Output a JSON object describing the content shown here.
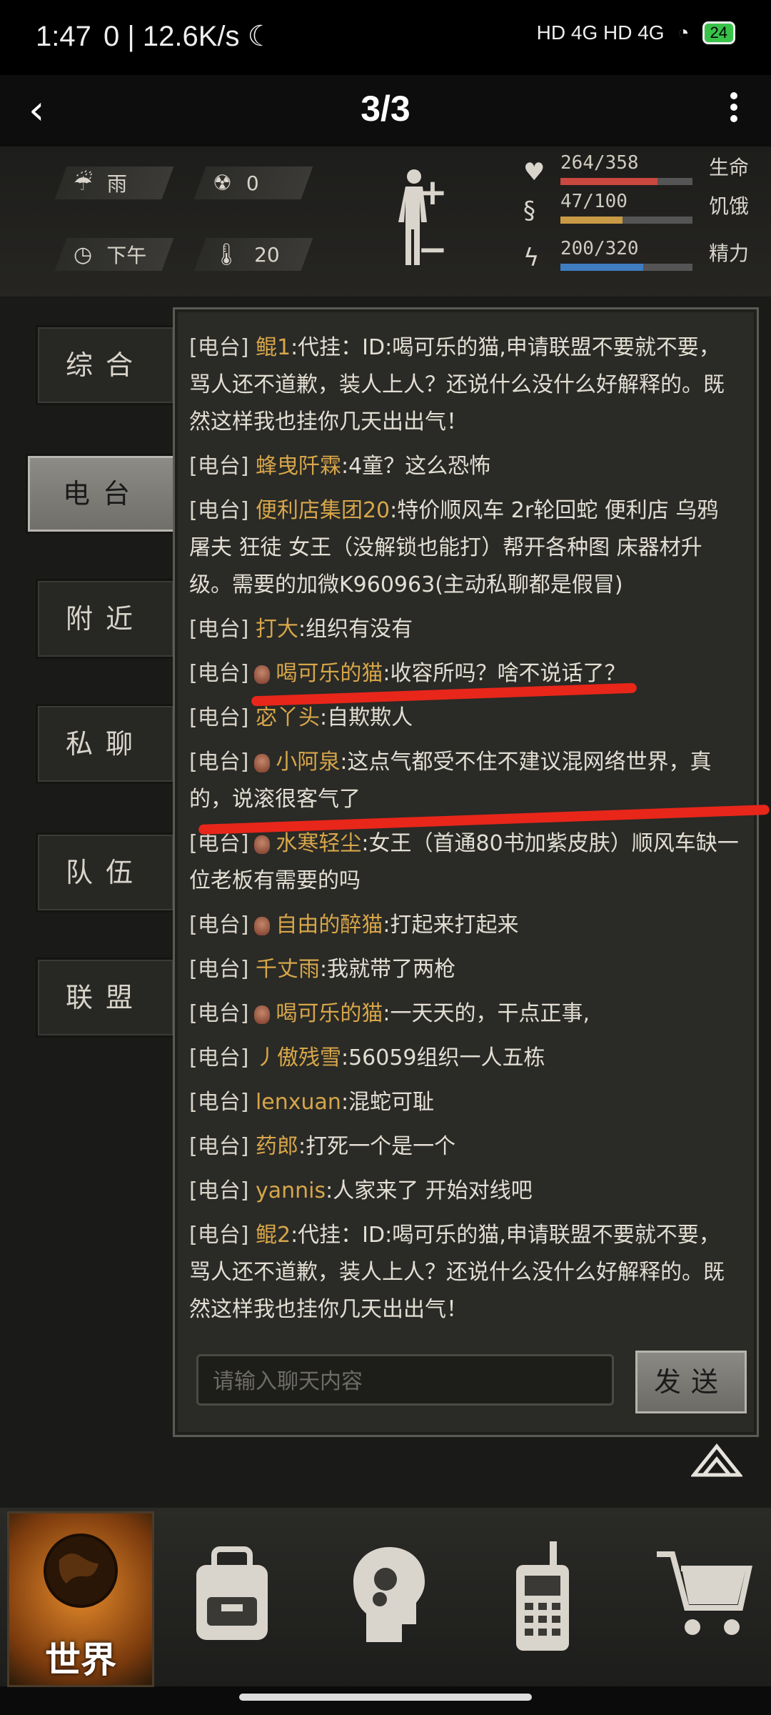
{
  "status_bar": {
    "time": "1:47",
    "speed": "0 | 12.6K/s",
    "right": "HD 4G HD 4G",
    "battery": "24"
  },
  "nav": {
    "page_indicator": "3/3"
  },
  "hud": {
    "weather": "雨",
    "radiation": "0",
    "time_of_day": "下午",
    "temperature": "20",
    "health": {
      "text": "264/358",
      "label": "生命",
      "current": 264,
      "max": 358,
      "color": "#c9483f"
    },
    "hunger": {
      "text": "47/100",
      "label": "饥饿",
      "current": 47,
      "max": 100,
      "color": "#c99a45"
    },
    "energy": {
      "text": "200/320",
      "label": "精力",
      "current": 200,
      "max": 320,
      "color": "#3f7dc0"
    }
  },
  "tabs": [
    {
      "label": "综合",
      "active": false
    },
    {
      "label": "电台",
      "active": true
    },
    {
      "label": "附近",
      "active": false
    },
    {
      "label": "私聊",
      "active": false
    },
    {
      "label": "队伍",
      "active": false
    },
    {
      "label": "联盟",
      "active": false
    }
  ],
  "messages": [
    {
      "tag": "[电台]",
      "name": "鲲1",
      "text": ":代挂：ID:喝可乐的猫,申请联盟不要就不要，骂人还不道歉，装人上人？还说什么没什么好解释的。既然这样我也挂你几天出出气！",
      "badge": false
    },
    {
      "tag": "[电台]",
      "name": "蜂曳阡霖",
      "text": ":4童？这么恐怖",
      "badge": false
    },
    {
      "tag": "[电台]",
      "name": "便利店集团20",
      "text": ":特价顺风车 2r轮回蛇 便利店 乌鸦 屠夫 狂徒 女王（没解锁也能打）帮开各种图 床器材升级。需要的加微K960963(主动私聊都是假冒)",
      "badge": false
    },
    {
      "tag": "[电台]",
      "name": "打大",
      "text": ":组织有没有",
      "badge": false
    },
    {
      "tag": "[电台]",
      "name": "喝可乐的猫",
      "text": ":收容所吗？啥不说话了？",
      "badge": true
    },
    {
      "tag": "[电台]",
      "name": "宓丫头",
      "text": ":自欺欺人",
      "badge": false
    },
    {
      "tag": "[电台]",
      "name": "小阿泉",
      "text": ":这点气都受不住不建议混网络世界，真的，说滚很客气了",
      "badge": true
    },
    {
      "tag": "[电台]",
      "name": "水寒轻尘",
      "text": ":女王（首通80书加紫皮肤）顺风车缺一位老板有需要的吗",
      "badge": true
    },
    {
      "tag": "[电台]",
      "name": "自由的醉猫",
      "text": ":打起来打起来",
      "badge": true
    },
    {
      "tag": "[电台]",
      "name": "千丈雨",
      "text": ":我就带了两枪",
      "badge": false
    },
    {
      "tag": "[电台]",
      "name": "喝可乐的猫",
      "text": ":一天天的，干点正事,",
      "badge": true
    },
    {
      "tag": "[电台]",
      "name": "丿傲残雪",
      "text": ":56059组织一人五栋",
      "badge": false
    },
    {
      "tag": "[电台]",
      "name": "lenxuan",
      "text": ":混蛇可耻",
      "badge": false
    },
    {
      "tag": "[电台]",
      "name": "药郎",
      "text": ":打死一个是一个",
      "badge": false
    },
    {
      "tag": "[电台]",
      "name": "yannis",
      "text": ":人家来了 开始对线吧",
      "badge": false
    },
    {
      "tag": "[电台]",
      "name": "鲲2",
      "text": ":代挂：ID:喝可乐的猫,申请联盟不要就不要，骂人还不道歉，装人上人？还说什么没什么好解释的。既然这样我也挂你几天出出气！",
      "badge": false
    }
  ],
  "chat_input": {
    "placeholder": "请输入聊天内容"
  },
  "send_label": "发送",
  "dock": {
    "world_label": "世界",
    "items": [
      "backpack-icon",
      "skills-head-icon",
      "radio-icon",
      "shop-cart-icon"
    ]
  },
  "colors": {
    "annotation_red": "#e8261a",
    "name_gold": "#d7a64a"
  }
}
